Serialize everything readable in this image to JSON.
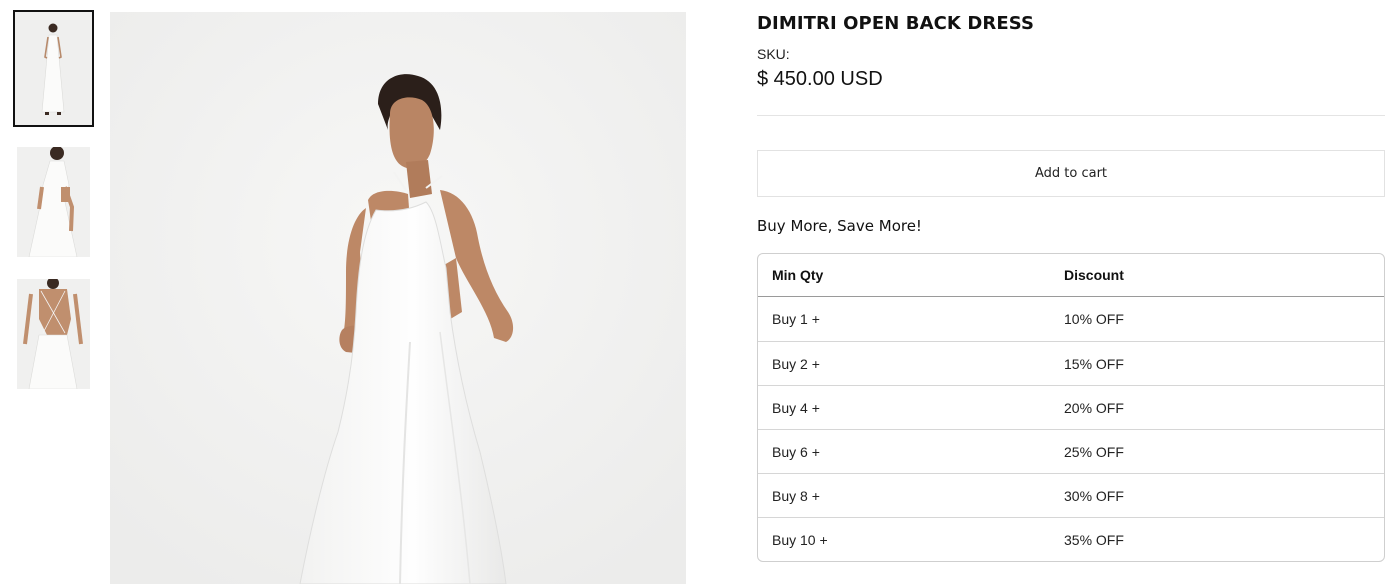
{
  "product": {
    "title": "DIMITRI OPEN BACK DRESS",
    "sku_label": "SKU:",
    "price": "$ 450.00 USD"
  },
  "gallery": {
    "thumbnails": [
      "front-view",
      "side-view",
      "back-view"
    ],
    "active_index": 0
  },
  "cart": {
    "add_to_cart_label": "Add to cart"
  },
  "bulk_discount": {
    "heading": "Buy More, Save More!",
    "columns": [
      "Min Qty",
      "Discount"
    ],
    "rows": [
      {
        "qty": "Buy 1 +",
        "discount": "10% OFF"
      },
      {
        "qty": "Buy 2 +",
        "discount": "15% OFF"
      },
      {
        "qty": "Buy 4 +",
        "discount": "20% OFF"
      },
      {
        "qty": "Buy 6 +",
        "discount": "25% OFF"
      },
      {
        "qty": "Buy 8 +",
        "discount": "30% OFF"
      },
      {
        "qty": "Buy 10 +",
        "discount": "35% OFF"
      }
    ]
  },
  "colors": {
    "accent": "#111111",
    "border": "#e2e2e2",
    "image_bg": "#f0f0ef"
  }
}
